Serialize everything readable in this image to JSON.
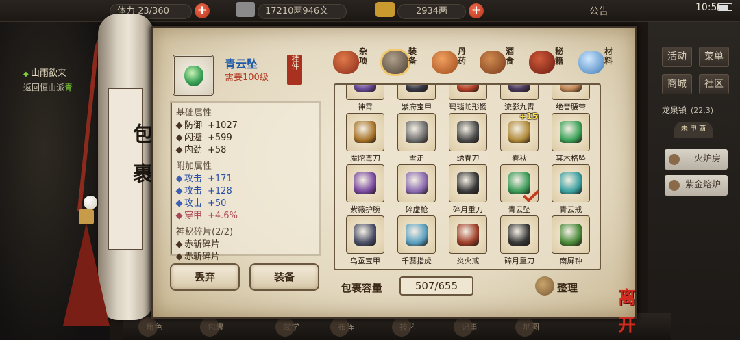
{
  "topbar": {
    "stamina": "体力 23/360",
    "silver": "17210两946文",
    "gold": "2934两",
    "notice": "公告",
    "clock": "10:56"
  },
  "quest": {
    "title": "山雨欲来",
    "desc_prefix": "返回恒山派",
    "desc_hl": "青"
  },
  "sidebar_right": {
    "buttons": [
      "活动",
      "菜单",
      "商城",
      "社区"
    ],
    "location": "龙泉镇",
    "coords": "(22,3)",
    "day": "未 申 酉",
    "facilities": [
      "火炉房",
      "紫金熔炉"
    ]
  },
  "bottom_menu": [
    "角色",
    "包裹",
    "武学",
    "布阵",
    "技艺",
    "记事",
    "地图"
  ],
  "scroll": {
    "title": "包裹"
  },
  "selected_item": {
    "name": "青云坠",
    "level": "需要100级",
    "tag": "挂件",
    "icon": "jade-pendant-icon"
  },
  "stats": {
    "base_header": "基础属性",
    "base": [
      {
        "name": "防御",
        "value": "+1027"
      },
      {
        "name": "闪避",
        "value": "+599"
      },
      {
        "name": "内劲",
        "value": "+58"
      }
    ],
    "extra_header": "附加属性",
    "extra": [
      {
        "name": "攻击",
        "value": "+171",
        "color": "blue"
      },
      {
        "name": "攻击",
        "value": "+128",
        "color": "blue"
      },
      {
        "name": "攻击",
        "value": "+50",
        "color": "blue"
      },
      {
        "name": "穿甲",
        "value": "+4.6%",
        "color": "red"
      }
    ],
    "shard_header": "神秘碎片(2/2)",
    "shards": [
      "赤斩碎片",
      "赤斩碎片"
    ]
  },
  "actions": {
    "discard": "丢弃",
    "equip": "装备"
  },
  "tabs": [
    {
      "label": "杂项",
      "icon": "jar-icon",
      "color": "#b5472c"
    },
    {
      "label": "装备",
      "icon": "scroll-armor-icon",
      "color": "#7a6a58",
      "active": true
    },
    {
      "label": "丹药",
      "icon": "pills-icon",
      "color": "#c9753a"
    },
    {
      "label": "酒食",
      "icon": "wine-jar-icon",
      "color": "#a9653a"
    },
    {
      "label": "秘籍",
      "icon": "book-icon",
      "color": "#b03a2a"
    },
    {
      "label": "材料",
      "icon": "crystal-icon",
      "color": "#6aa6d8"
    }
  ],
  "items": [
    {
      "name": "神霄",
      "color": "#6a4c9a"
    },
    {
      "name": "紫府宝甲",
      "color": "#3a3a48"
    },
    {
      "name": "玛瑙蛇形镯",
      "color": "#b8432a"
    },
    {
      "name": "流影九霄",
      "color": "#4c3c5e"
    },
    {
      "name": "绝音腰带",
      "color": "#c48a5a"
    },
    {
      "name": "魔陀弯刀",
      "color": "#a8742a"
    },
    {
      "name": "雪走",
      "color": "#6e6e6e"
    },
    {
      "name": "绣春刀",
      "color": "#4a4a4a"
    },
    {
      "name": "春秋",
      "color": "#b08a3a",
      "plus": "+15"
    },
    {
      "name": "其木格坠",
      "color": "#3aa258"
    },
    {
      "name": "紫薇护腕",
      "color": "#7a4aa0"
    },
    {
      "name": "碎虚枪",
      "color": "#8a6ab0"
    },
    {
      "name": "碎月重刀",
      "color": "#383838"
    },
    {
      "name": "青云坠",
      "color": "#3a9a58",
      "checked": true
    },
    {
      "name": "青云戒",
      "color": "#3aa0a0"
    },
    {
      "name": "乌蚕宝甲",
      "color": "#4a5068"
    },
    {
      "name": "千蕊指虎",
      "color": "#5aa0c0"
    },
    {
      "name": "炎火戒",
      "color": "#a0402a"
    },
    {
      "name": "碎月重刀",
      "color": "#383838"
    },
    {
      "name": "南屏钟",
      "color": "#4a8a3a"
    }
  ],
  "capacity": {
    "label": "包裹容量",
    "value": "507/655"
  },
  "sort": {
    "label": "整理"
  },
  "leave": {
    "label": "离开"
  }
}
